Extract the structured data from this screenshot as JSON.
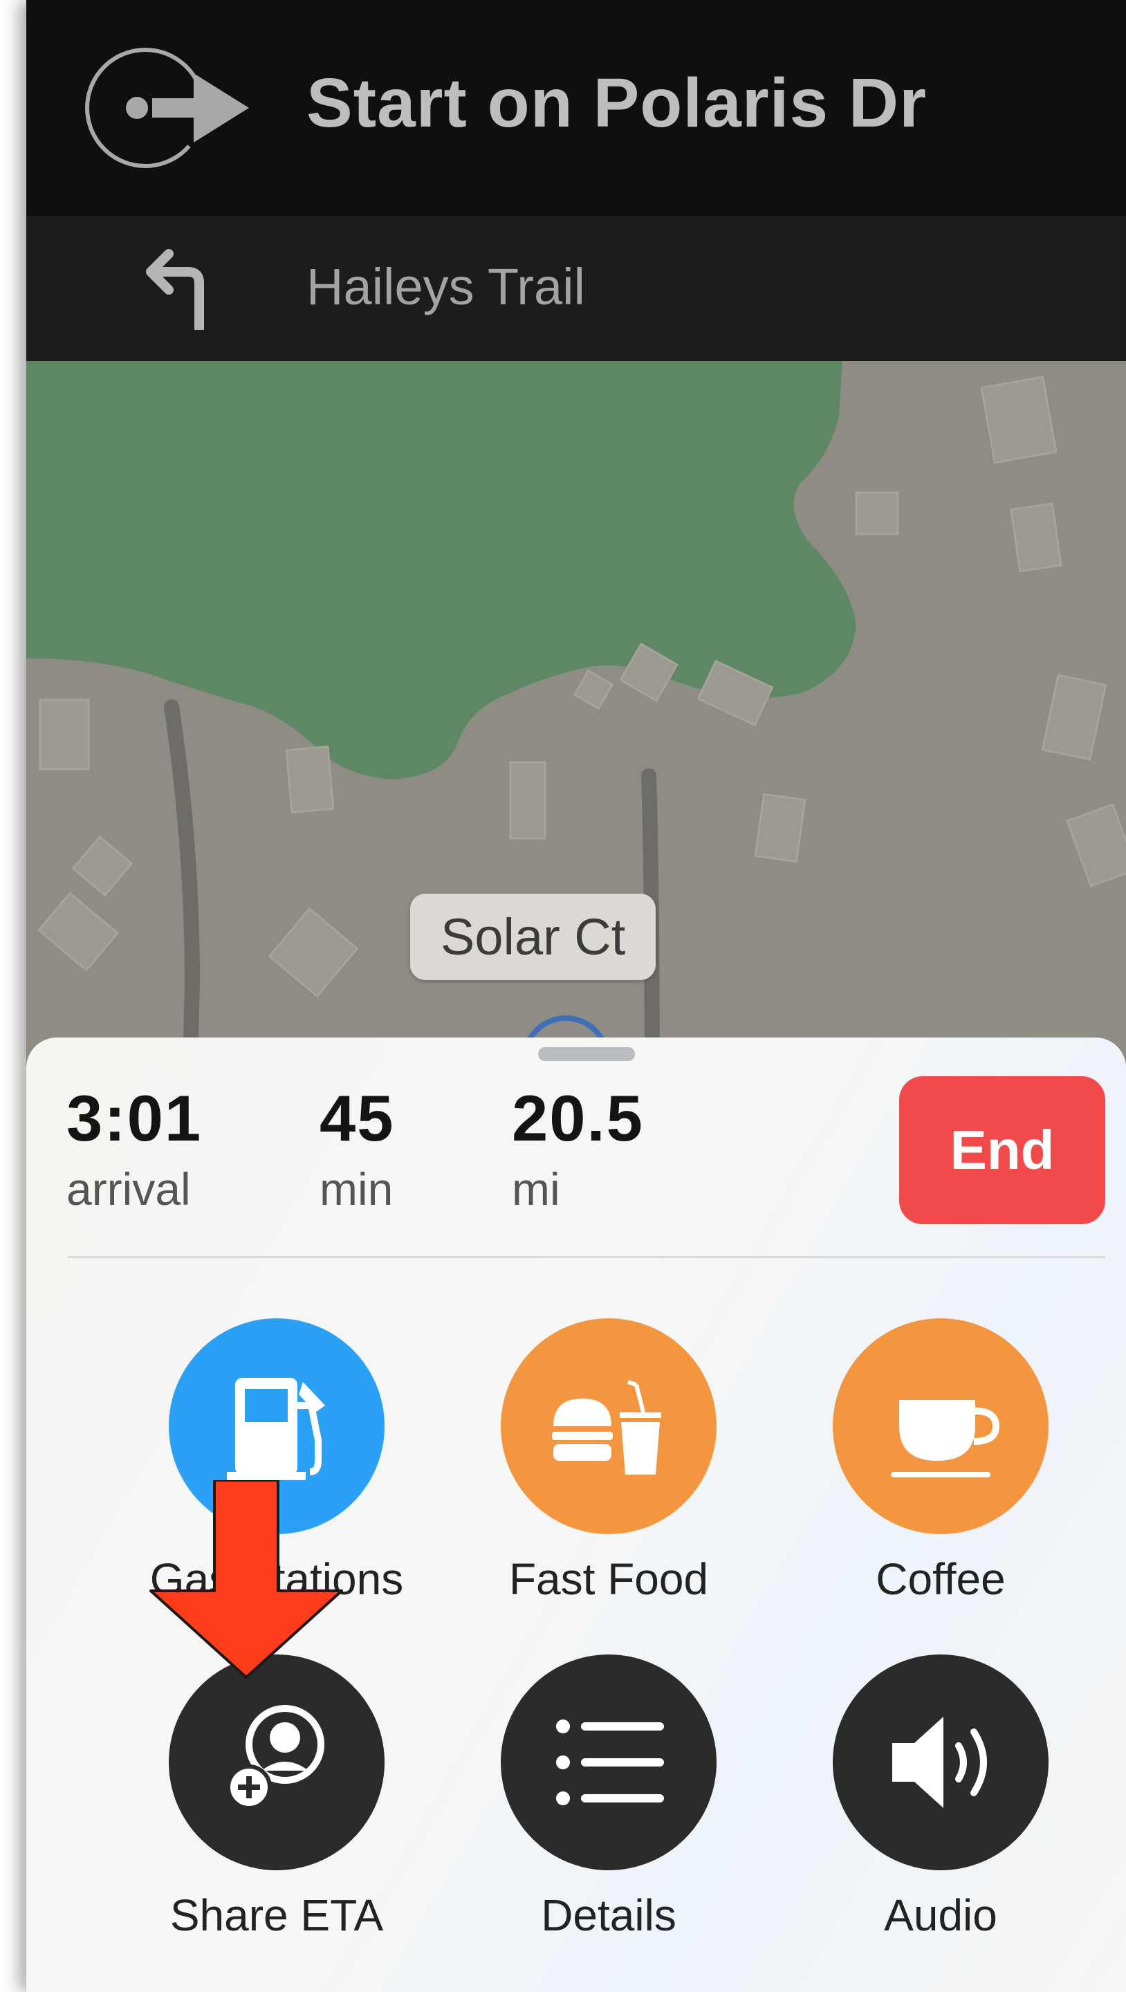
{
  "navigation": {
    "primary_instruction": "Start on Polaris Dr",
    "next_street": "Haileys Trail"
  },
  "map": {
    "street_label": "Solar Ct"
  },
  "trip": {
    "arrival_value": "3:01",
    "arrival_unit": "arrival",
    "time_value": "45",
    "time_unit": "min",
    "distance_value": "20.5",
    "distance_unit": "mi",
    "end_label": "End"
  },
  "actions": [
    {
      "label": "Gas Stations",
      "icon": "gas-pump-icon",
      "color": "#2aa1f7"
    },
    {
      "label": "Fast Food",
      "icon": "burger-drink-icon",
      "color": "#f4963f"
    },
    {
      "label": "Coffee",
      "icon": "coffee-cup-icon",
      "color": "#f4963f"
    },
    {
      "label": "Share ETA",
      "icon": "share-person-icon",
      "color": "#2b2b2b"
    },
    {
      "label": "Details",
      "icon": "list-icon",
      "color": "#2b2b2b"
    },
    {
      "label": "Audio",
      "icon": "speaker-icon",
      "color": "#2b2b2b"
    }
  ],
  "colors": {
    "end_button": "#f24a4a",
    "park": "#5d8863",
    "highlight_arrow": "#ff3d1a"
  }
}
